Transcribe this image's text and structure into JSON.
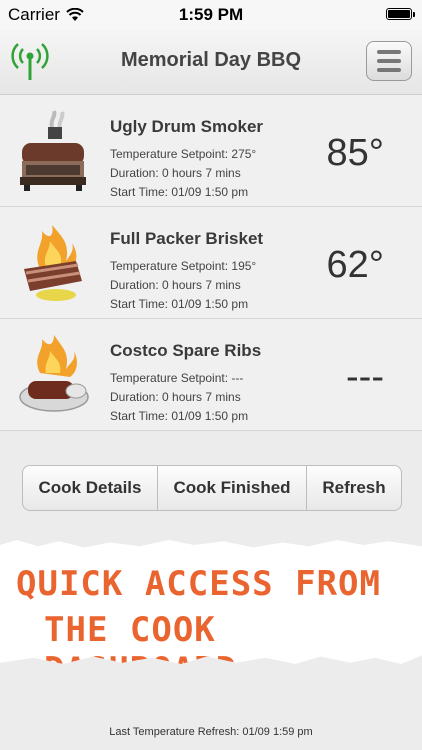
{
  "status_bar": {
    "carrier": "Carrier",
    "time": "1:59 PM"
  },
  "header": {
    "title": "Memorial Day BBQ"
  },
  "cooks": [
    {
      "name": "Ugly Drum Smoker",
      "setpoint": "Temperature Setpoint: 275°",
      "duration": "Duration: 0 hours 7 mins",
      "start": "Start Time: 01/09 1:50 pm",
      "temp": "85°",
      "icon": "smoker-icon"
    },
    {
      "name": "Full Packer Brisket",
      "setpoint": "Temperature Setpoint: 195°",
      "duration": "Duration: 0 hours 7 mins",
      "start": "Start Time: 01/09 1:50 pm",
      "temp": "62°",
      "icon": "brisket-icon"
    },
    {
      "name": "Costco Spare Ribs",
      "setpoint": "Temperature Setpoint: ---",
      "duration": "Duration: 0 hours 7 mins",
      "start": "Start Time: 01/09 1:50 pm",
      "temp": "---",
      "icon": "ribs-icon"
    }
  ],
  "actions": {
    "details": "Cook Details",
    "finished": "Cook Finished",
    "refresh": "Refresh"
  },
  "banner": {
    "line1": "QUICK ACCESS FROM",
    "line2": "THE COOK DASHBOARD"
  },
  "footer": {
    "refresh_text": "Last Temperature Refresh: 01/09 1:59 pm"
  },
  "colors": {
    "accent": "#e9642f",
    "signal": "#2fa335",
    "fire": "#f2a22b"
  }
}
